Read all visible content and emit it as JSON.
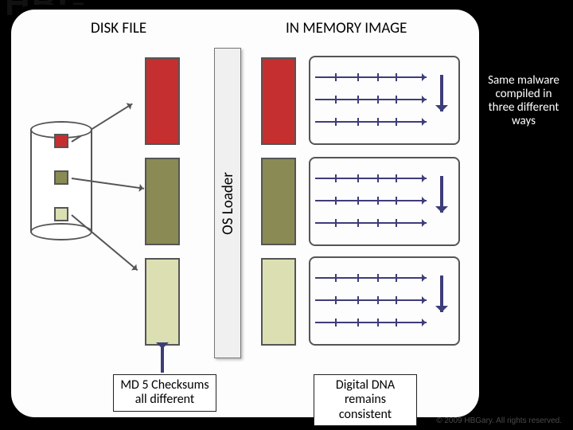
{
  "headings": {
    "disk_file": "DISK FILE",
    "in_memory": "IN MEMORY IMAGE"
  },
  "os_loader_label": "OS Loader",
  "annotation": "Same malware compiled in three different ways",
  "captions": {
    "md5": "MD 5 Checksums all different",
    "ddna": "Digital DNA remains consistent"
  },
  "colors": {
    "variant1": "#c62f2f",
    "variant2": "#8a8b54",
    "variant3": "#dcdfb2",
    "arrow": "#3d3d7a"
  },
  "copyright": "© 2009 HBGary. All rights reserved."
}
